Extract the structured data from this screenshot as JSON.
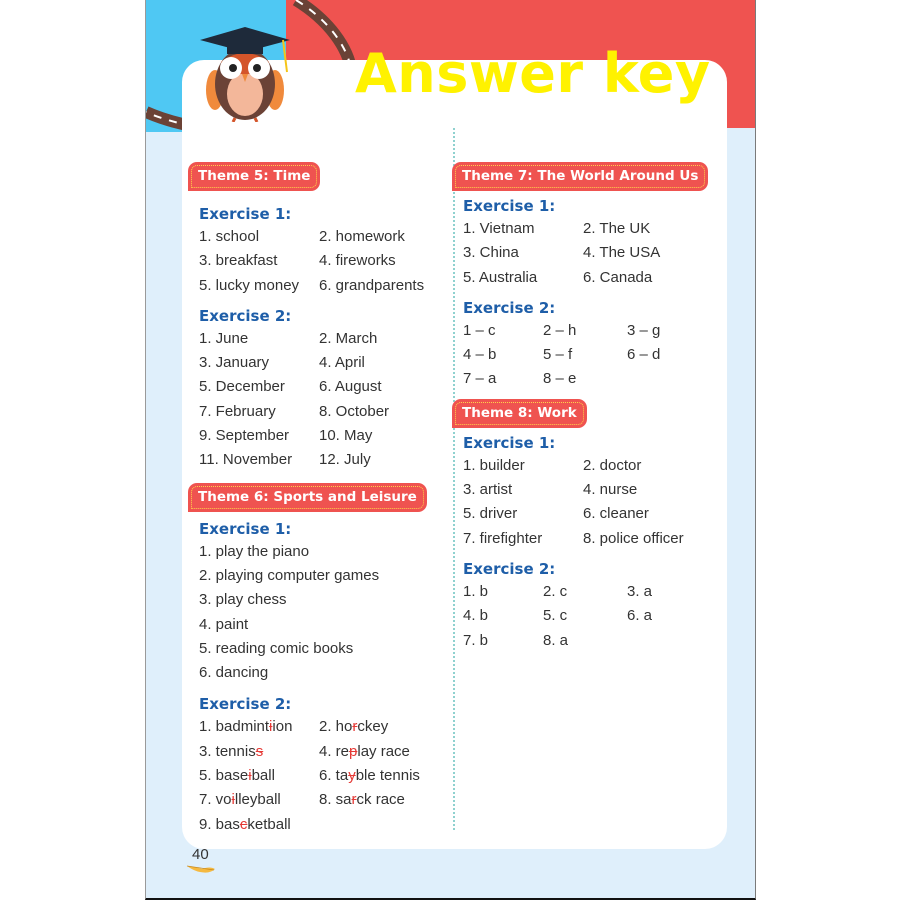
{
  "header": {
    "title": "Answer key"
  },
  "page_number": "40",
  "icons": {
    "mascot": "owl-graduate-icon",
    "feather": "feather-icon"
  },
  "colors": {
    "header_red": "#ef5350",
    "header_blue": "#4fc8f3",
    "title_yellow": "#fff200",
    "exercise_blue": "#1e5ea8",
    "background": "#dfeffb"
  },
  "themes": [
    {
      "label": "Theme 5: Time",
      "exercises": [
        {
          "label": "Exercise 1:",
          "rows": [
            [
              "1. school",
              "2. homework"
            ],
            [
              "3. breakfast",
              "4. fireworks"
            ],
            [
              "5. lucky money",
              "6. grandparents"
            ]
          ]
        },
        {
          "label": "Exercise 2:",
          "rows": [
            [
              "1. June",
              "2. March"
            ],
            [
              "3. January",
              "4. April"
            ],
            [
              "5. December",
              "6. August"
            ],
            [
              "7. February",
              "8. October"
            ],
            [
              "9. September",
              "10. May"
            ],
            [
              "11. November",
              "12. July"
            ]
          ]
        }
      ]
    },
    {
      "label": "Theme 6: Sports and Leisure",
      "exercises": [
        {
          "label": "Exercise 1:",
          "rows": [
            [
              "1. play the piano"
            ],
            [
              "2. playing computer games"
            ],
            [
              "3. play chess"
            ],
            [
              "4. paint"
            ],
            [
              "5. reading comic books"
            ],
            [
              "6. dancing"
            ]
          ]
        },
        {
          "label": "Exercise 2:",
          "rows": [
            [
              {
                "pre": "1. badmint",
                "x": "i",
                "post": "ion"
              },
              {
                "pre": "2. ho",
                "x": "r",
                "post": "ckey"
              }
            ],
            [
              {
                "pre": "3. tennis",
                "x": "s",
                "post": ""
              },
              {
                "pre": "4. re",
                "x": "p",
                "post": "lay race"
              }
            ],
            [
              {
                "pre": "5. base",
                "x": "i",
                "post": "ball"
              },
              {
                "pre": "6. ta",
                "x": "y",
                "post": "ble tennis"
              }
            ],
            [
              {
                "pre": "7. vo",
                "x": "i",
                "post": "lleyball"
              },
              {
                "pre": "8. sa",
                "x": "r",
                "post": "ck race"
              }
            ],
            [
              {
                "pre": "9. bas",
                "x": "c",
                "post": "ketball"
              }
            ]
          ]
        }
      ]
    },
    {
      "label": "Theme 7: The World Around Us",
      "exercises": [
        {
          "label": "Exercise 1:",
          "rows": [
            [
              "1. Vietnam",
              "2. The UK"
            ],
            [
              "3. China",
              "4. The USA"
            ],
            [
              "5. Australia",
              "6. Canada"
            ]
          ]
        },
        {
          "label": "Exercise 2:",
          "rows": [
            [
              "1 – c",
              "2 – h",
              "3 – g"
            ],
            [
              "4 – b",
              "5 – f",
              "6 – d"
            ],
            [
              "7 – a",
              "8 – e"
            ]
          ]
        }
      ]
    },
    {
      "label": "Theme 8: Work",
      "exercises": [
        {
          "label": "Exercise 1:",
          "rows": [
            [
              "1. builder",
              "2. doctor"
            ],
            [
              "3. artist",
              "4. nurse"
            ],
            [
              "5. driver",
              "6. cleaner"
            ],
            [
              "7. firefighter",
              "8. police officer"
            ]
          ]
        },
        {
          "label": "Exercise 2:",
          "rows": [
            [
              "1. b",
              "2. c",
              "3. a"
            ],
            [
              "4. b",
              "5. c",
              "6. a"
            ],
            [
              "7. b",
              "8. a"
            ]
          ]
        }
      ]
    }
  ]
}
